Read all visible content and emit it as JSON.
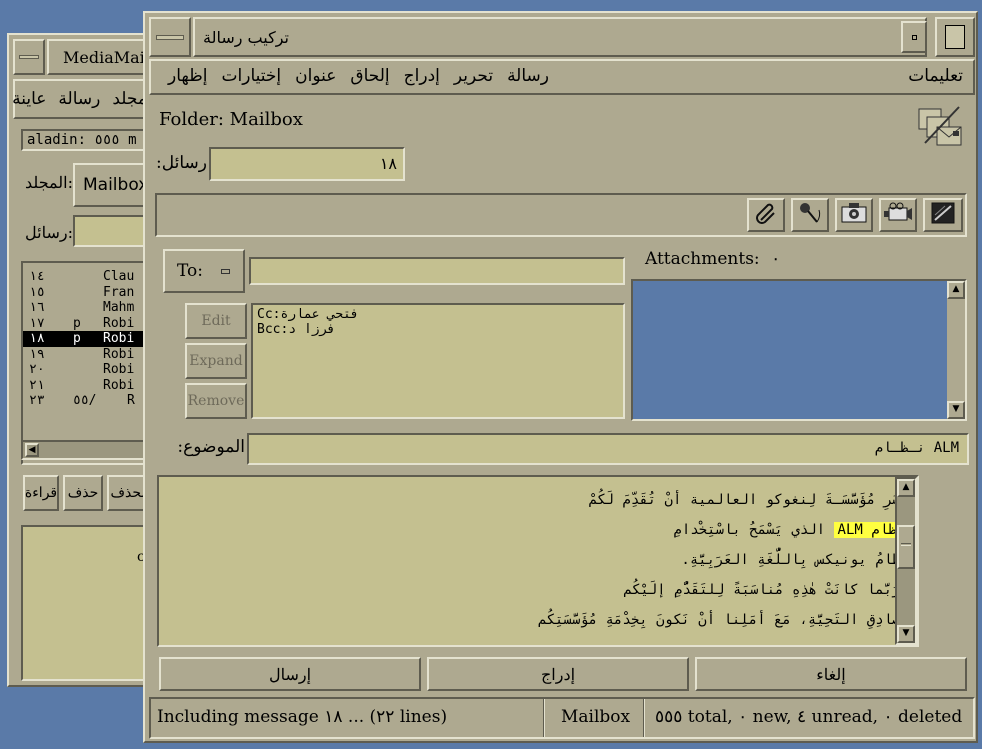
{
  "back_window": {
    "title": "MediaMail",
    "menu": [
      "مجلد",
      "رسالة",
      "عاينة"
    ],
    "account": "aladin: ٥٥٥ m",
    "folder_label": "المجلد:",
    "folder_value": "Mailbox",
    "messages_label": "رسائل:",
    "list": [
      {
        "num": "١٤",
        "flag": "",
        "sender": "Clau"
      },
      {
        "num": "١٥",
        "flag": "",
        "sender": "Fran"
      },
      {
        "num": "١٦",
        "flag": "",
        "sender": "Mahm"
      },
      {
        "num": "١٧",
        "flag": "p",
        "sender": "Robi"
      },
      {
        "num": "١٨",
        "flag": "p",
        "sender": "Robi"
      },
      {
        "num": "١٩",
        "flag": "",
        "sender": "Robi"
      },
      {
        "num": "٢٠",
        "flag": "",
        "sender": "Robi"
      },
      {
        "num": "٢١",
        "flag": "",
        "sender": "Robi"
      },
      {
        "num": "٢٣",
        "flag": "٥٥/",
        "sender": "R"
      }
    ],
    "buttons": [
      "قراءة",
      "حذف",
      "الحذف"
    ],
    "preview_char": "c"
  },
  "compose": {
    "title": "تركيب رسالة",
    "menu": [
      "رسالة",
      "تحرير",
      "إدراج",
      "إلحاق",
      "عنوان",
      "إختيارات",
      "إظهار"
    ],
    "help": "تعليمات",
    "folder": "Folder: Mailbox",
    "messages_label": "رسائل:",
    "messages_value": "١٨",
    "to_label": "To:",
    "to_value": "",
    "recipients": [
      "Cc:فتحي عمارة",
      "Bcc:فرزا د"
    ],
    "edit": "Edit",
    "expand": "Expand",
    "remove": "Remove",
    "attachments_label": "Attachments:",
    "attachments_count": "٠",
    "subject_label": "الموضوع:",
    "subject_value": "نـظـام ALM",
    "body_lines": [
      "بِسُرِ مُؤَسَّسَـةَ لِنغوكو العالمية أنْ تُقَدِّمَ لَكُمْ",
      "الذي يَسْمَحُ باسْتِخْدامِ",
      "نِظامُ يونيكس بِاللُّغَةِ العَرَبِيَّةِ.",
      "وَرُبَّما كانَتْ هٰذِهِ مُناسَبَةً لِلتَقَدُّمِ إلَيْكُم",
      "بِصادِقِ التَحِيَّةِ، مَعَ أمَلِنا أنْ نَكونَ بِخِدْمَةِ مُؤَسَّسَتِكُم"
    ],
    "highlight": "نِظام ALM",
    "cancel": "إلغاء",
    "insert": "إدراج",
    "send": "إرسال",
    "status_message": "Including message ١٨ ... (٢٢ lines)",
    "status_folder": "Mailbox",
    "status_counts": "٥٥٥ total, ٠ new, ٤ unread, ٠ deleted"
  }
}
